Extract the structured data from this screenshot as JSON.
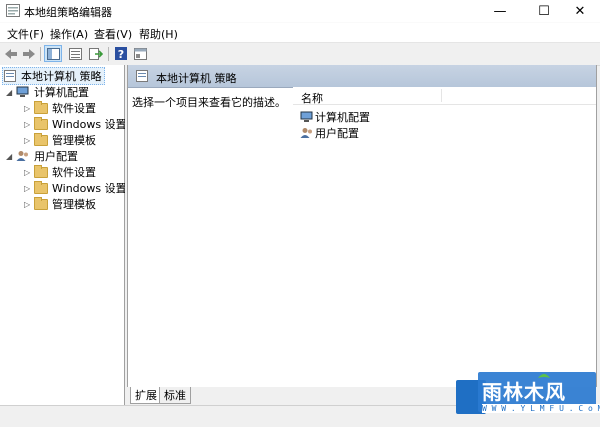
{
  "window": {
    "title": "本地组策略编辑器",
    "controls": {
      "minimize": "—",
      "maximize": "☐",
      "close": "✕"
    }
  },
  "menu": [
    "文件(F)",
    "操作(A)",
    "查看(V)",
    "帮助(H)"
  ],
  "toolbar": {
    "buttons": [
      "back-arrow-icon",
      "forward-arrow-icon",
      "show-hide-tree-icon",
      "list-view-icon",
      "export-list-icon",
      "help-icon",
      "properties-icon"
    ]
  },
  "tree": {
    "root": "本地计算机 策略",
    "computer": {
      "label": "计算机配置",
      "children": [
        "软件设置",
        "Windows 设置",
        "管理模板"
      ]
    },
    "user": {
      "label": "用户配置",
      "children": [
        "软件设置",
        "Windows 设置",
        "管理模板"
      ]
    }
  },
  "detail": {
    "header": "本地计算机 策略",
    "description": "选择一个项目来查看它的描述。",
    "column_name": "名称",
    "items": [
      "计算机配置",
      "用户配置"
    ]
  },
  "tabs": [
    "扩展",
    "标准"
  ],
  "watermark": {
    "brand": "雨林木风",
    "url": "W W W . Y L M F U . C o M"
  },
  "colors": {
    "header_bg": "#c0cde0",
    "folder": "#e9c46a",
    "watermark_blue": "#1f6fc4"
  }
}
